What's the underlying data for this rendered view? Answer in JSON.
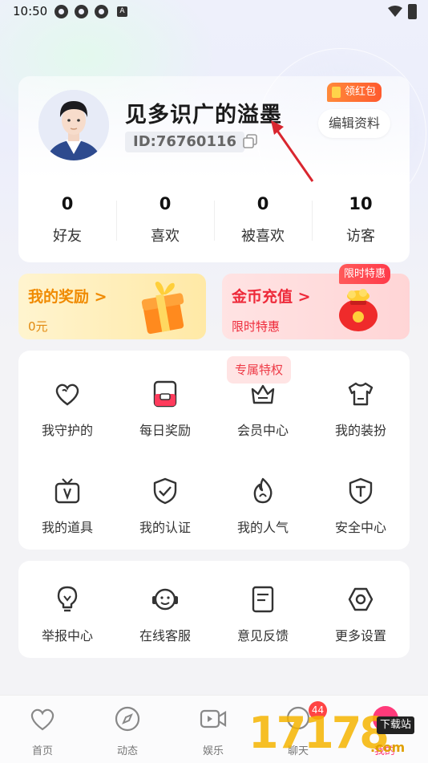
{
  "status_bar": {
    "time": "10:50",
    "indicator_letter": "A"
  },
  "profile": {
    "nickname": "见多识广的溢墨",
    "id_text": "ID:76760116",
    "edit_label": "编辑资料",
    "redpacket_label": "领红包"
  },
  "stats": [
    {
      "value": "0",
      "label": "好友"
    },
    {
      "value": "0",
      "label": "喜欢"
    },
    {
      "value": "0",
      "label": "被喜欢"
    },
    {
      "value": "10",
      "label": "访客"
    }
  ],
  "promos": {
    "reward": {
      "title": "我的奖励",
      "subtitle": "0元",
      "chevron": ">"
    },
    "coins": {
      "title": "金币充值",
      "subtitle": "限时特惠",
      "chevron": ">",
      "badge": "限时特惠"
    }
  },
  "features": {
    "vip_tag": "专属特权",
    "items": [
      {
        "label": "我守护的",
        "icon": "heart-icon"
      },
      {
        "label": "每日奖励",
        "icon": "daily-reward-icon"
      },
      {
        "label": "会员中心",
        "icon": "crown-icon"
      },
      {
        "label": "我的装扮",
        "icon": "shirt-icon"
      },
      {
        "label": "我的道具",
        "icon": "tv-box-icon"
      },
      {
        "label": "我的认证",
        "icon": "shield-check-icon"
      },
      {
        "label": "我的人气",
        "icon": "flame-icon"
      },
      {
        "label": "安全中心",
        "icon": "shield-t-icon"
      }
    ]
  },
  "services": {
    "items": [
      {
        "label": "举报中心",
        "icon": "bulb-icon"
      },
      {
        "label": "在线客服",
        "icon": "headset-icon"
      },
      {
        "label": "意见反馈",
        "icon": "feedback-icon"
      },
      {
        "label": "更多设置",
        "icon": "settings-icon"
      }
    ]
  },
  "tabbar": {
    "tabs": [
      {
        "label": "首页",
        "icon": "heart-tab-icon"
      },
      {
        "label": "动态",
        "icon": "compass-tab-icon"
      },
      {
        "label": "娱乐",
        "icon": "video-tab-icon"
      },
      {
        "label": "聊天",
        "icon": "chat-tab-icon"
      },
      {
        "label": "我的",
        "icon": "me-tab-icon"
      }
    ],
    "chat_badge": "44"
  },
  "watermark": {
    "text": "17178",
    "suffix": ".com",
    "download_label": "下载站"
  },
  "colors": {
    "accent_red": "#ee2a3a",
    "reward_orange": "#f08a00",
    "redpack_orange": "#ff6a30"
  }
}
